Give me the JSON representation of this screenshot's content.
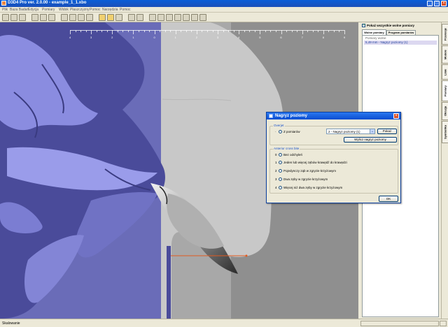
{
  "window": {
    "title": "D3D4 Pro ver. 2.0.00 - example_1_1.xbo"
  },
  "menu": [
    "Plik",
    "Baza Badań",
    "Edycja",
    "Pomiary",
    "Widok",
    "Płaszczyzny",
    "Pomoc",
    "Narzędzia",
    "Pomoc"
  ],
  "right_panel": {
    "checkbox_label": "Pokaż wszystkie wolne pomiary",
    "tabs": [
      "Wolne pomiary",
      "Program pomiarów"
    ],
    "section_label": "Pomiary wolne",
    "selected_item": "5,49 mm - Nagryz poziomy (1)"
  },
  "vertical_tabs": [
    "Przekroje",
    "Modele",
    "Linie",
    "Pomiary",
    "Okluzja",
    "Symbolika"
  ],
  "status": {
    "text": "Skalowanie"
  },
  "ruler": {
    "labels": [
      "4",
      "3",
      "2",
      "1",
      "0",
      "1",
      "2",
      "3",
      "4",
      "5",
      "6",
      "7",
      "8",
      "9"
    ]
  },
  "dialog": {
    "title": "Nagryz poziomy",
    "close": "×",
    "group1": {
      "label": "Overjet",
      "radio_label": "Z pomiarów",
      "combo_value": "2 - Nagryz poziomy (1)",
      "combo_arrow": "⌄",
      "pokaz_button": "Pokaż",
      "compute_button": "Wylicz nagryz poziomy"
    },
    "group2": {
      "label": "Anterior cross bite",
      "options": [
        {
          "num": "0",
          "label": "Bez odchyleń"
        },
        {
          "num": "1",
          "label": "Jeden lub więcej zębów krawędź do krawędzi"
        },
        {
          "num": "2",
          "label": "Pojedynczy ząb w zgryzie krzyżowym"
        },
        {
          "num": "3",
          "label": "Dwa zęby w zgryzie krzyżowym"
        },
        {
          "num": "4",
          "label": "Więcej niż dwa zęby w zgryzie krzyżowym"
        }
      ]
    },
    "ok_button": "OK"
  },
  "colors": {
    "model_left": "#6a6cb8",
    "model_right": "#8f8f8f",
    "measure_line": "#e05a20"
  }
}
